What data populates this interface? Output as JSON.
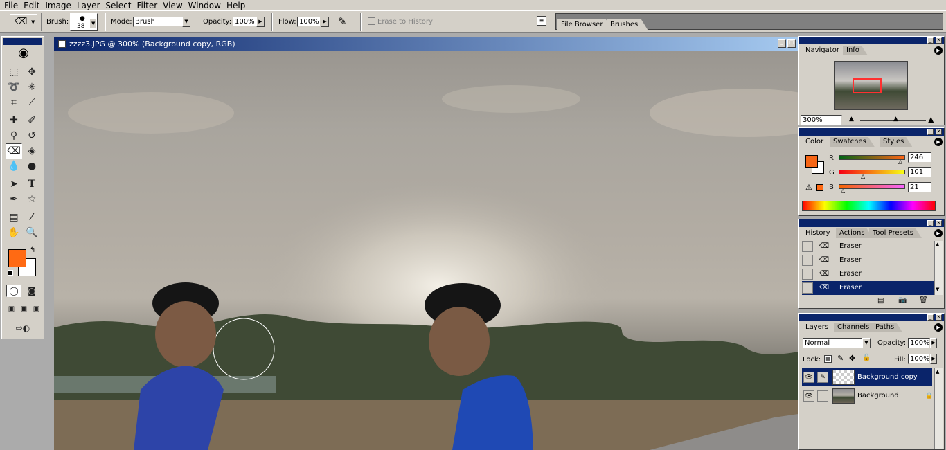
{
  "menu": [
    "File",
    "Edit",
    "Image",
    "Layer",
    "Select",
    "Filter",
    "View",
    "Window",
    "Help"
  ],
  "options": {
    "brush_label": "Brush:",
    "brush_size": "38",
    "mode_label": "Mode:",
    "mode_value": "Brush",
    "opacity_label": "Opacity:",
    "opacity_value": "100%",
    "flow_label": "Flow:",
    "flow_value": "100%",
    "erase_history": "Erase to History"
  },
  "well_tabs": [
    "File Browser",
    "Brushes"
  ],
  "document": {
    "title": "zzzz3.JPG @ 300% (Background copy, RGB)"
  },
  "navigator": {
    "tabs": [
      "Navigator",
      "Info"
    ],
    "zoom": "300%"
  },
  "color": {
    "tabs": [
      "Color",
      "Swatches",
      "Styles"
    ],
    "foreground": "#f66515",
    "r_label": "R",
    "r_value": "246",
    "g_label": "G",
    "g_value": "101",
    "b_label": "B",
    "b_value": "21"
  },
  "history": {
    "tabs": [
      "History",
      "Actions",
      "Tool Presets"
    ],
    "items": [
      "Eraser",
      "Eraser",
      "Eraser",
      "Eraser"
    ]
  },
  "layers": {
    "tabs": [
      "Layers",
      "Channels",
      "Paths"
    ],
    "blend_mode": "Normal",
    "opacity_label": "Opacity:",
    "opacity_value": "100%",
    "lock_label": "Lock:",
    "fill_label": "Fill:",
    "fill_value": "100%",
    "items": [
      "Background copy",
      "Background"
    ]
  },
  "colors": {
    "accent": "#0a246a",
    "foreground_swatch": "#ff6a13"
  }
}
